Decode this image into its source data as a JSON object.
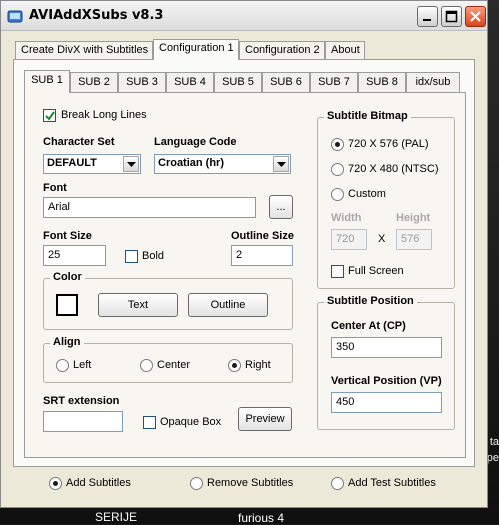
{
  "window": {
    "title": "AVIAddXSubs v8.3"
  },
  "top_tabs": [
    {
      "label": "Create DivX with Subtitles",
      "active": false
    },
    {
      "label": "Configuration 1",
      "active": true
    },
    {
      "label": "Configuration 2",
      "active": false
    },
    {
      "label": "About",
      "active": false
    }
  ],
  "sub_tabs": [
    {
      "label": "SUB 1",
      "active": true
    },
    {
      "label": "SUB 2"
    },
    {
      "label": "SUB 3"
    },
    {
      "label": "SUB 4"
    },
    {
      "label": "SUB 5"
    },
    {
      "label": "SUB 6"
    },
    {
      "label": "SUB 7"
    },
    {
      "label": "SUB 8"
    },
    {
      "label": "idx/sub"
    }
  ],
  "left": {
    "break_long_lines_label": "Break Long Lines",
    "break_long_lines_checked": true,
    "character_set_label": "Character Set",
    "character_set_value": "DEFAULT",
    "language_code_label": "Language Code",
    "language_code_value": "Croatian (hr)",
    "font_label": "Font",
    "font_value": "Arial",
    "font_browse_label": "...",
    "font_size_label": "Font Size",
    "font_size_value": "25",
    "bold_label": "Bold",
    "outline_size_label": "Outline Size",
    "outline_size_value": "2",
    "color_group_title": "Color",
    "color_swatch": "#ffffff",
    "text_button": "Text",
    "outline_button": "Outline",
    "align_group_title": "Align",
    "align_left": "Left",
    "align_center": "Center",
    "align_right": "Right",
    "align_selected": "Right",
    "srt_extension_label": "SRT extension",
    "srt_extension_value": "",
    "opaque_box_label": "Opaque Box",
    "preview_button": "Preview"
  },
  "right": {
    "bitmap_group_title": "Subtitle Bitmap",
    "res_pal": "720 X 576 (PAL)",
    "res_ntsc": "720 X 480 (NTSC)",
    "res_custom": "Custom",
    "res_selected": "720 X 576 (PAL)",
    "width_label": "Width",
    "width_value": "720",
    "x_label": "X",
    "height_label": "Height",
    "height_value": "576",
    "full_screen_label": "Full Screen",
    "position_group_title": "Subtitle Position",
    "center_at_label": "Center At (CP)",
    "center_at_value": "350",
    "vertical_position_label": "Vertical Position (VP)",
    "vertical_position_value": "450"
  },
  "bottom": {
    "add_subtitles": "Add Subtitles",
    "remove_subtitles": "Remove Subtitles",
    "add_test_subtitles": "Add Test Subtitles",
    "selected": "Add Subtitles"
  },
  "desktop": {
    "label_1": "SERIJE",
    "label_2": "furious 4",
    "side_1": "ta",
    "side_2": "pe"
  }
}
